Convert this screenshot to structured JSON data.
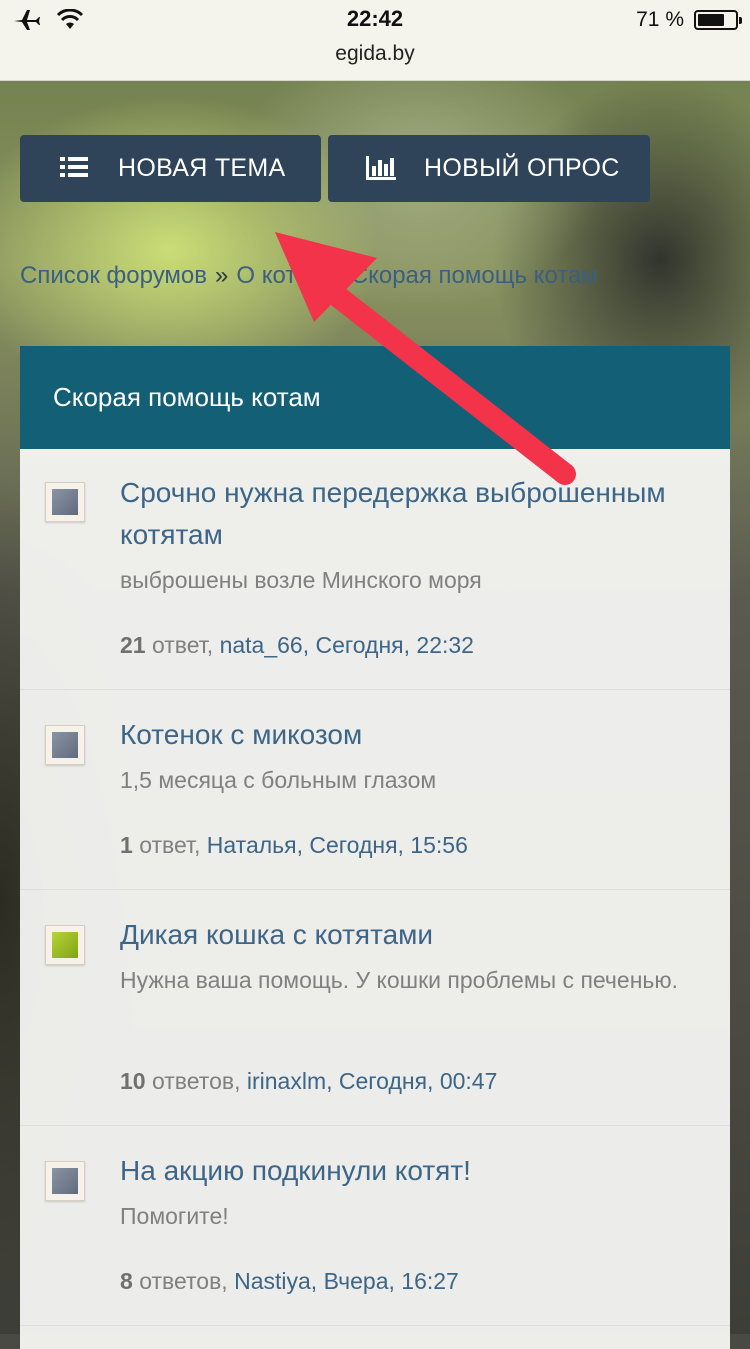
{
  "status_bar": {
    "time": "22:42",
    "url": "egida.by",
    "battery": "71 %",
    "battery_level": 0.71
  },
  "actions": {
    "new_topic_label": "НОВАЯ ТЕМА",
    "new_poll_label": "НОВЫЙ ОПРОС"
  },
  "breadcrumb": {
    "items": [
      "Список форумов",
      "О котах",
      "Скорая помощь котам"
    ],
    "separator": "»"
  },
  "forum": {
    "title": "Скорая помощь котам",
    "topics": [
      {
        "title": "Срочно нужна передержка выброшенным котятам",
        "description": "выброшены возле Минского моря",
        "replies_count": "21",
        "replies_word": "ответ,",
        "author": "nata_66,",
        "last_post": "Сегодня, 22:32",
        "status": "read"
      },
      {
        "title": "Котенок с микозом",
        "description": "1,5 месяца с больным глазом",
        "replies_count": "1",
        "replies_word": "ответ,",
        "author": "Наталья,",
        "last_post": "Сегодня, 15:56",
        "status": "read"
      },
      {
        "title": "Дикая кошка с котятами",
        "description": "Нужна ваша помощь. У кошки проблемы с печенью.",
        "replies_count": "10",
        "replies_word": "ответов,",
        "author": "irinaxlm,",
        "last_post": "Сегодня, 00:47",
        "status": "unread"
      },
      {
        "title": "На акцию подкинули котят!",
        "description": "Помогите!",
        "replies_count": "8",
        "replies_word": "ответов,",
        "author": "Nastiya,",
        "last_post": "Вчера, 16:27",
        "status": "read"
      }
    ]
  },
  "colors": {
    "button_bg": "#2f4458",
    "header_bg": "#125f76",
    "link": "#3c6587",
    "arrow": "#f2334a",
    "unread_icon": "#9cc12a",
    "read_icon": "#6f7a8b"
  },
  "icons": [
    "airplane-icon",
    "wifi-icon",
    "battery-icon",
    "list-icon",
    "bar-chart-icon",
    "topic-read-icon",
    "topic-unread-icon",
    "annotation-arrow"
  ]
}
